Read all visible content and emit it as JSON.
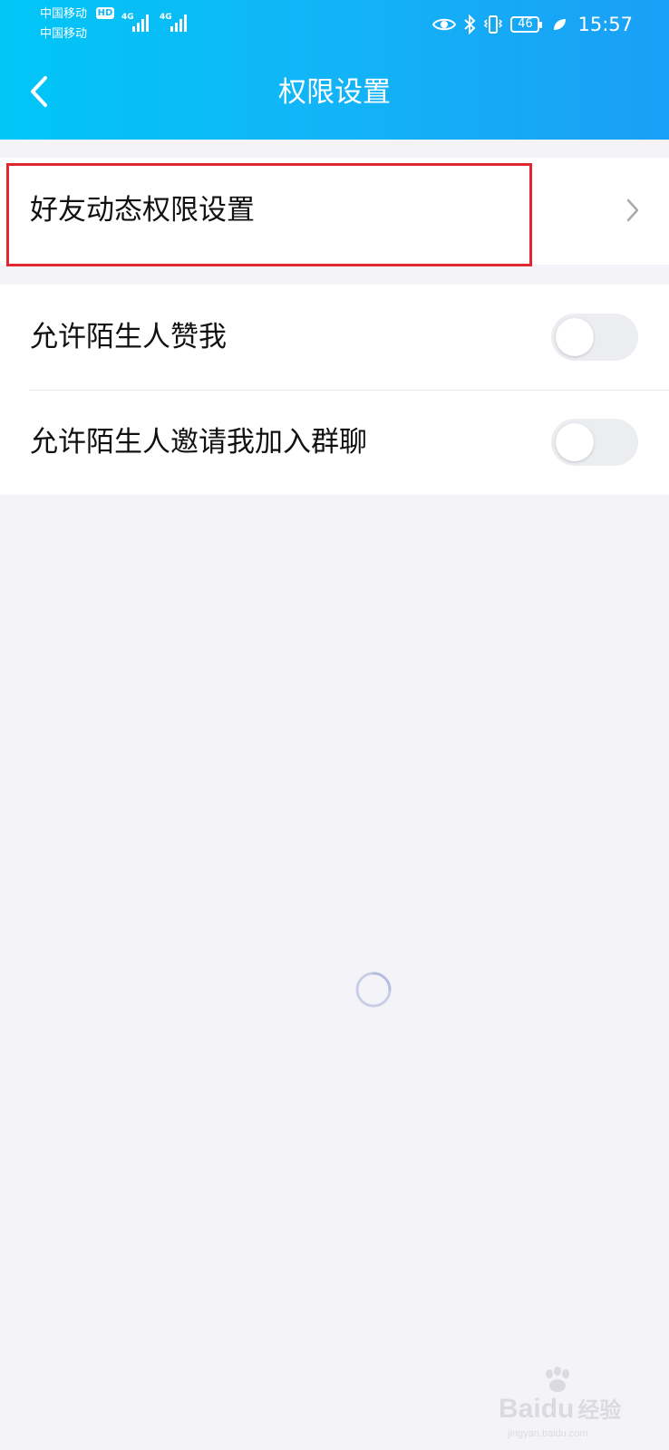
{
  "status_bar": {
    "carrier_1": "中国移动",
    "hd_badge": "HD",
    "carrier_2": "中国移动",
    "network_1": "4G",
    "network_2": "4G",
    "battery_level": "46",
    "time": "15:57"
  },
  "header": {
    "title": "权限设置",
    "back_icon": "chevron-left-icon"
  },
  "sections": [
    {
      "rows": [
        {
          "label": "好友动态权限设置",
          "type": "link",
          "highlighted": true
        }
      ]
    },
    {
      "rows": [
        {
          "label": "允许陌生人赞我",
          "type": "toggle",
          "checked": false
        },
        {
          "label": "允许陌生人邀请我加入群聊",
          "type": "toggle",
          "checked": false
        }
      ]
    }
  ],
  "loading": true,
  "watermark": {
    "brand": "Bai",
    "brand2": "du",
    "product": "经验",
    "url": "jingyan.baidu.com"
  },
  "colors": {
    "header_gradient_start": "#00c6f6",
    "header_gradient_end": "#1a9ff6",
    "highlight_border": "#e0262e",
    "page_background": "#f4f4f8",
    "toggle_off": "#ecedf1"
  }
}
